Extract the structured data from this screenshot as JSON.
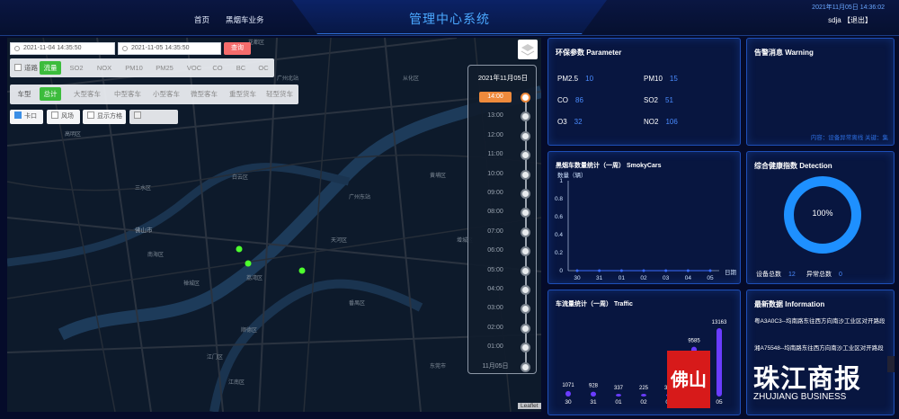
{
  "header": {
    "nav_home": "首页",
    "nav_business": "黑烟车业务",
    "title": "管理中心系统",
    "datetime": "2021年11月05日 14:36:02",
    "user": "sdja",
    "logout": "【退出】"
  },
  "filters": {
    "start": "2021-11-04 14:35:50",
    "end": "2021-11-05 14:35:50",
    "query_label": "查询",
    "pollutants": [
      "流量",
      "SO2",
      "NOX",
      "PM10",
      "PM25",
      "VOC",
      "CO",
      "BC",
      "OC"
    ],
    "reverse_label": "道路",
    "vehicle_type_label": "车型",
    "vehicle_types": [
      "总计",
      "大型客车",
      "中型客车",
      "小型客车",
      "微型客车",
      "重型货车",
      "轻型货车"
    ],
    "options": [
      "卡口",
      "风场",
      "显示方格"
    ]
  },
  "map_labels": [
    "花都区",
    "广州北站",
    "从化区",
    "高明区",
    "三水区",
    "白云区",
    "佛山市",
    "南海区",
    "黄埔区",
    "广州东站",
    "天河区",
    "增城区",
    "番禺区",
    "顺德区",
    "江门区",
    "东莞市",
    "禅城区",
    "荔湾区",
    "江南区"
  ],
  "leaflet": "Leaflet",
  "timeline": {
    "date": "2021年11月05日",
    "hours": [
      "14:00",
      "13:00",
      "12:00",
      "11:00",
      "10:00",
      "09:00",
      "08:00",
      "07:00",
      "06:00",
      "05:00",
      "04:00",
      "03:00",
      "02:00",
      "01:00",
      "11月05日"
    ],
    "active": 0
  },
  "env": {
    "title": "环保参数 Parameter",
    "items": [
      {
        "k": "PM2.5",
        "v": "10"
      },
      {
        "k": "PM10",
        "v": "15"
      },
      {
        "k": "CO",
        "v": "86"
      },
      {
        "k": "SO2",
        "v": "51"
      },
      {
        "k": "O3",
        "v": "32"
      },
      {
        "k": "NO2",
        "v": "106"
      }
    ]
  },
  "warning": {
    "title": "告警消息 Warning",
    "note": "内容：设备异常离线 关键：集"
  },
  "smoky": {
    "title": "黑烟车数量统计（一周） SmokyCars",
    "ylabel": "数量（辆）",
    "xlabel": "日期"
  },
  "health": {
    "title": "综合健康指数 Detection",
    "percent": "100%",
    "total_label": "设备总数",
    "total": "12",
    "abnormal_label": "异常总数",
    "abnormal": "0"
  },
  "traffic": {
    "title": "车流量统计（一周） Traffic"
  },
  "latest": {
    "title": "最新数据 Information",
    "items": [
      "粤A3A0C3--均南路东往西方向南沙工业区对开路段",
      "湘A75548--均南路东往西方向南沙工业区对开路段"
    ]
  },
  "watermark": {
    "brand": "佛山",
    "name": "珠江商报",
    "latin": "ZHUJIANG BUSINESS"
  },
  "chart_data": [
    {
      "type": "line",
      "title": "黑烟车数量统计（一周） SmokyCars",
      "ylabel": "数量（辆）",
      "xlabel": "日期",
      "categories": [
        "30",
        "31",
        "01",
        "02",
        "03",
        "04",
        "05"
      ],
      "values": [
        0,
        0,
        0,
        0,
        0,
        0,
        0
      ],
      "ylim": [
        0,
        1
      ],
      "yticks": [
        "0",
        "0.2",
        "0.4",
        "0.6",
        "0.8",
        "1"
      ]
    },
    {
      "type": "bar",
      "title": "车流量统计（一周） Traffic",
      "categories": [
        "30",
        "31",
        "01",
        "02",
        "03",
        "04",
        "05"
      ],
      "values": [
        1071,
        928,
        337,
        225,
        303,
        9585,
        13163
      ]
    }
  ]
}
